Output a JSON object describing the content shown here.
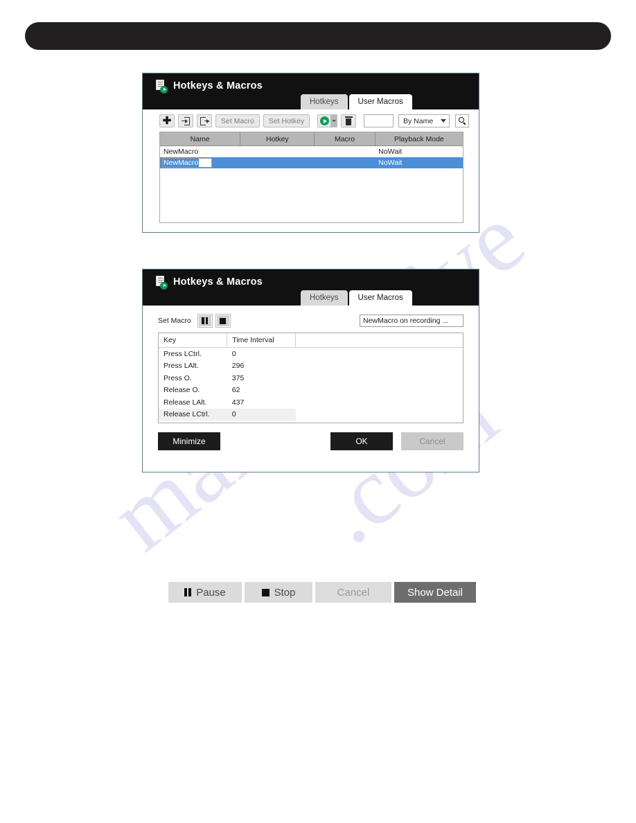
{
  "watermark": {
    "line1": "manualshive",
    "line2": ".com"
  },
  "top_bar": {
    "label": ""
  },
  "panel_hotkeys_list": {
    "title": "Hotkeys & Macros",
    "title_icon": "document-play-icon",
    "tabs": [
      {
        "label": "Hotkeys",
        "active": false
      },
      {
        "label": "User Macros",
        "active": true
      }
    ],
    "toolbar": {
      "add_icon": "plus-icon",
      "import_icon": "import-icon",
      "export_icon": "export-icon",
      "set_macro_label": "Set Macro",
      "set_hotkey_label": "Set Hotkey",
      "play_icon": "play-icon",
      "play_dropdown_icon": "chevron-down-icon",
      "delete_icon": "trash-icon",
      "search_value": "",
      "search_placeholder": "",
      "sort_selected": "By Name",
      "sort_caret_icon": "chevron-down-icon",
      "search_icon": "search-icon"
    },
    "table": {
      "columns": [
        "Name",
        "Hotkey",
        "Macro",
        "Playback Mode"
      ],
      "rows": [
        {
          "name": "NewMacro",
          "hotkey": "",
          "macro": "",
          "playback_mode": "NoWait",
          "selected": false,
          "editing": false
        },
        {
          "name": "NewMacro",
          "hotkey": "",
          "macro": "",
          "playback_mode": "NoWait",
          "selected": true,
          "editing": true
        }
      ]
    }
  },
  "panel_set_macro": {
    "title": "Hotkeys & Macros",
    "title_icon": "document-play-icon",
    "tabs": [
      {
        "label": "Hotkeys",
        "active": false
      },
      {
        "label": "User Macros",
        "active": true
      }
    ],
    "set_macro_label": "Set Macro",
    "pause_icon": "pause-icon",
    "stop_icon": "stop-icon",
    "recording_field_value": "NewMacro on recording ...",
    "table": {
      "columns": [
        "Key",
        "Time Interval",
        ""
      ],
      "rows": [
        {
          "key": "Press LCtrl.",
          "interval": "0"
        },
        {
          "key": "Press LAlt.",
          "interval": "296"
        },
        {
          "key": "Press O.",
          "interval": "375"
        },
        {
          "key": "Release O.",
          "interval": "62"
        },
        {
          "key": "Release LAlt.",
          "interval": "437"
        },
        {
          "key": "Release LCtrl.",
          "interval": "0"
        }
      ]
    },
    "buttons": {
      "minimize": "Minimize",
      "ok": "OK",
      "cancel": "Cancel"
    }
  },
  "bottom_bar": {
    "buttons": [
      {
        "label": "Pause",
        "icon": "pause-icon",
        "style": "light"
      },
      {
        "label": "Stop",
        "icon": "stop-icon",
        "style": "light"
      },
      {
        "label": "Cancel",
        "icon": "",
        "style": "muted"
      },
      {
        "label": "Show Detail",
        "icon": "",
        "style": "dark"
      }
    ]
  },
  "colors": {
    "panel_border": "#5d7f8c",
    "titlebar": "#111111",
    "selection_blue": "#4a8fd8",
    "header_gray": "#b6b6b6",
    "accent_green": "#0aa05a",
    "dark_button": "#1c1c1c",
    "disabled_gray": "#c9c9c9"
  }
}
